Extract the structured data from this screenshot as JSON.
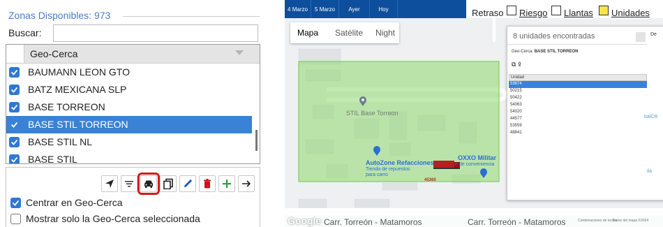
{
  "left_panel": {
    "zonas_title": "Zonas Disponibles: 973",
    "buscar_label": "Buscar:",
    "buscar_value": "",
    "list_header": "Geo-Cerca",
    "rows": [
      {
        "label": "BAUMANN LEON GTO",
        "checked": true,
        "selected": false
      },
      {
        "label": "BATZ MEXICANA SLP",
        "checked": true,
        "selected": false
      },
      {
        "label": "BASE TORREON",
        "checked": true,
        "selected": false
      },
      {
        "label": "BASE STIL TORREON",
        "checked": true,
        "selected": true
      },
      {
        "label": "BASE STIL NL",
        "checked": true,
        "selected": false
      },
      {
        "label": "BASE STIL",
        "checked": true,
        "selected": false
      }
    ],
    "toolbar_icons": [
      "navigate-icon",
      "filter-icon",
      "car-icon",
      "copy-icon",
      "edit-icon",
      "delete-icon",
      "add-icon",
      "arrow-right-icon"
    ],
    "options": [
      {
        "label": "Centrar en Geo-Cerca",
        "checked": true
      },
      {
        "label": "Mostrar solo la Geo-Cerca seleccionada",
        "checked": false
      }
    ],
    "accent_color": "#2f78d4",
    "selected_row_color": "#3a82d6",
    "title_color": "#4a7bd1",
    "highlight_color": "#d21d1d"
  },
  "map_panel": {
    "date_tabs": [
      "4 Marzo",
      "5 Marzo",
      "Ayer",
      "Hoy"
    ],
    "top_strip": {
      "retraso": "Retraso",
      "riesgo": "Riesgo",
      "llantas": "Llantas",
      "unidades": "Unidades"
    },
    "map_types": [
      "Mapa",
      "Satélite",
      "Night"
    ],
    "active_map_type": "Mapa",
    "pois": {
      "stil": "STIL Base Torreon",
      "autozone": "AutoZone Refacciones",
      "autozone_sub1": "Tienda de repuestos",
      "autozone_sub2": "para carro",
      "oxxo": "OXXO Militar",
      "oxxo_sub": "e de conveniencia",
      "street_number": "45360"
    },
    "roads": [
      "Carr. Torreón - Matamoros",
      "Carr. Torreón - Matamoros"
    ],
    "google_logo": "Google",
    "attribution": [
      "Combinaciones de teclas",
      "Datos del mapa ©2024"
    ],
    "geofence_color": "#8fd96f",
    "overlay": {
      "found": "8 unidades encontradas",
      "geo_label": "Geo-Cerca:",
      "geo_value": "BASE STIL TORREON",
      "column": "Unidad",
      "units": [
        "53674",
        "50215",
        "50422",
        "54063",
        "54020",
        "44577",
        "53559",
        "48841"
      ],
      "selected_unit": "53674",
      "side_labels": [
        "De",
        "balCR",
        "ila"
      ]
    }
  }
}
